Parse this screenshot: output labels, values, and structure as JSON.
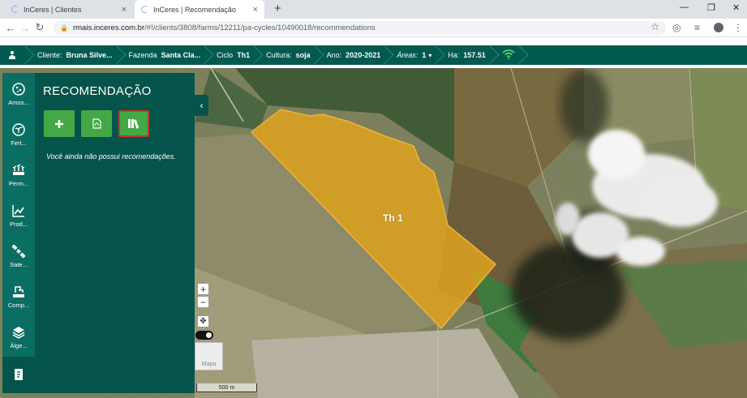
{
  "browser": {
    "tabs": [
      {
        "title": "InCeres | Clientes",
        "close": "×"
      },
      {
        "title": "InCeres | Recomendação",
        "close": "×"
      }
    ],
    "new_tab": "+",
    "url_domain": "rmais.inceres.com.br",
    "url_path": "/#!/clients/3808/farms/12211/pa-cycles/10490018/recommendations"
  },
  "header": {
    "cliente_label": "Cliente:",
    "cliente_value": "Bruna Silve...",
    "fazenda_label": "Fazenda",
    "fazenda_value": "Santa Cla...",
    "ciclo_label": "Ciclo",
    "ciclo_value": "Th1",
    "cultura_label": "Cultura:",
    "cultura_value": "soja",
    "ano_label": "Ano:",
    "ano_value": "2020-2021",
    "areas_label": "Áreas:",
    "areas_value": "1",
    "ha_label": "Ha:",
    "ha_value": "157.51"
  },
  "sidebar": {
    "items": [
      {
        "label": "Amos...",
        "icon": "sample-icon"
      },
      {
        "label": "Fert...",
        "icon": "fertility-icon"
      },
      {
        "label": "Perm...",
        "icon": "permission-icon"
      },
      {
        "label": "Prod...",
        "icon": "productivity-icon"
      },
      {
        "label": "Sate...",
        "icon": "satellite-icon"
      },
      {
        "label": "Comp...",
        "icon": "compaction-icon"
      },
      {
        "label": "Álge...",
        "icon": "algebra-icon"
      }
    ]
  },
  "panel": {
    "title": "RECOMENDAÇÃO",
    "empty_message": "Você ainda não possui recomendações."
  },
  "map": {
    "field_label": "Th 1",
    "zoom_in": "+",
    "zoom_out": "−",
    "basemap_label": "Mapa",
    "scale_label": "500 m",
    "field_color": "#e3a51c"
  }
}
